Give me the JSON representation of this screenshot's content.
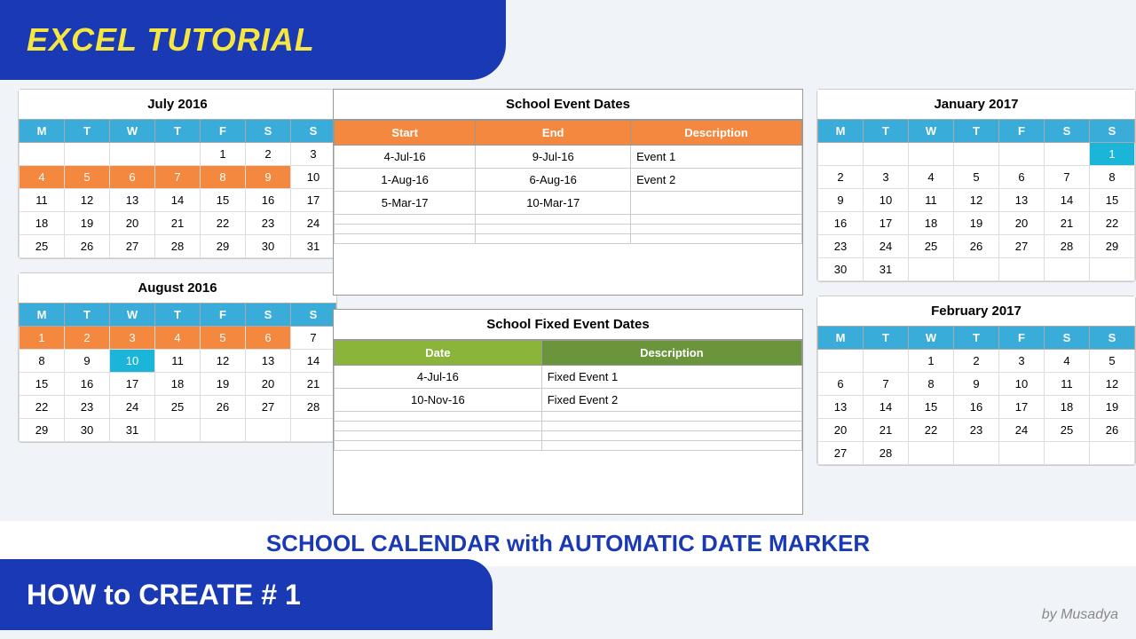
{
  "header": {
    "title": "EXCEL TUTORIAL"
  },
  "subtitle": "SCHOOL CALENDAR with AUTOMATIC DATE MARKER",
  "howto": "HOW to CREATE # 1",
  "author": "by Musadya",
  "calendars": {
    "july2016": {
      "title": "July 2016",
      "headers": [
        "M",
        "T",
        "W",
        "T",
        "F",
        "S",
        "S"
      ],
      "rows": [
        [
          "",
          "",
          "",
          "",
          "1",
          "2",
          "3"
        ],
        [
          "4",
          "5",
          "6",
          "7",
          "8",
          "9",
          "10"
        ],
        [
          "11",
          "12",
          "13",
          "14",
          "15",
          "16",
          "17"
        ],
        [
          "18",
          "19",
          "20",
          "21",
          "22",
          "23",
          "24"
        ],
        [
          "25",
          "26",
          "27",
          "28",
          "29",
          "30",
          "31"
        ]
      ],
      "highlights": {
        "orange": [
          [
            1,
            0
          ],
          [
            1,
            1
          ],
          [
            1,
            2
          ],
          [
            1,
            3
          ],
          [
            1,
            4
          ],
          [
            1,
            5
          ]
        ],
        "cyan": []
      }
    },
    "august2016": {
      "title": "August 2016",
      "headers": [
        "M",
        "T",
        "W",
        "T",
        "F",
        "S",
        "S"
      ],
      "rows": [
        [
          "1",
          "2",
          "3",
          "4",
          "5",
          "6",
          "7"
        ],
        [
          "8",
          "9",
          "10",
          "11",
          "12",
          "13",
          "14"
        ],
        [
          "15",
          "16",
          "17",
          "18",
          "19",
          "20",
          "21"
        ],
        [
          "22",
          "23",
          "24",
          "25",
          "26",
          "27",
          "28"
        ],
        [
          "29",
          "30",
          "31",
          "",
          "",
          "",
          ""
        ]
      ],
      "highlights": {
        "orange": [
          [
            0,
            0
          ],
          [
            0,
            1
          ],
          [
            0,
            2
          ],
          [
            0,
            3
          ],
          [
            0,
            4
          ],
          [
            0,
            5
          ]
        ],
        "cyan": [
          [
            1,
            2
          ]
        ]
      }
    },
    "january2017": {
      "title": "January 2017",
      "headers": [
        "M",
        "T",
        "W",
        "T",
        "F",
        "S",
        "S"
      ],
      "rows": [
        [
          "",
          "",
          "",
          "",
          "",
          "",
          "1"
        ],
        [
          "2",
          "3",
          "4",
          "5",
          "6",
          "7",
          "8"
        ],
        [
          "9",
          "10",
          "11",
          "12",
          "13",
          "14",
          "15"
        ],
        [
          "16",
          "17",
          "18",
          "19",
          "20",
          "21",
          "22"
        ],
        [
          "23",
          "24",
          "25",
          "26",
          "27",
          "28",
          "29"
        ],
        [
          "30",
          "31",
          "",
          "",
          "",
          "",
          ""
        ]
      ],
      "highlights": {
        "cyan": [
          [
            0,
            6
          ]
        ],
        "orange": []
      }
    },
    "february2017": {
      "title": "February 2017",
      "headers": [
        "M",
        "T",
        "W",
        "T",
        "F",
        "S",
        "S"
      ],
      "rows": [
        [
          "",
          "",
          "1",
          "2",
          "3",
          "4",
          "5"
        ],
        [
          "6",
          "7",
          "8",
          "9",
          "10",
          "11",
          "12"
        ],
        [
          "13",
          "14",
          "15",
          "16",
          "17",
          "18",
          "19"
        ],
        [
          "20",
          "21",
          "22",
          "23",
          "24",
          "25",
          "26"
        ],
        [
          "27",
          "28",
          "",
          "",
          "",
          "",
          ""
        ]
      ],
      "highlights": {
        "orange": [],
        "cyan": []
      }
    }
  },
  "school_events": {
    "title": "School Event Dates",
    "headers": [
      "Start",
      "End",
      "Description"
    ],
    "rows": [
      [
        "4-Jul-16",
        "9-Jul-16",
        "Event 1"
      ],
      [
        "1-Aug-16",
        "6-Aug-16",
        "Event 2"
      ],
      [
        "5-Mar-17",
        "10-Mar-17",
        ""
      ],
      [
        "",
        "",
        ""
      ],
      [
        "",
        "",
        ""
      ],
      [
        "",
        "",
        ""
      ]
    ]
  },
  "school_fixed_events": {
    "title": "School Fixed Event Dates",
    "headers": [
      "Date",
      "Description"
    ],
    "rows": [
      [
        "4-Jul-16",
        "Fixed Event 1"
      ],
      [
        "10-Nov-16",
        "Fixed Event 2"
      ],
      [
        "",
        ""
      ],
      [
        "",
        ""
      ],
      [
        "",
        ""
      ],
      [
        "",
        ""
      ]
    ]
  }
}
